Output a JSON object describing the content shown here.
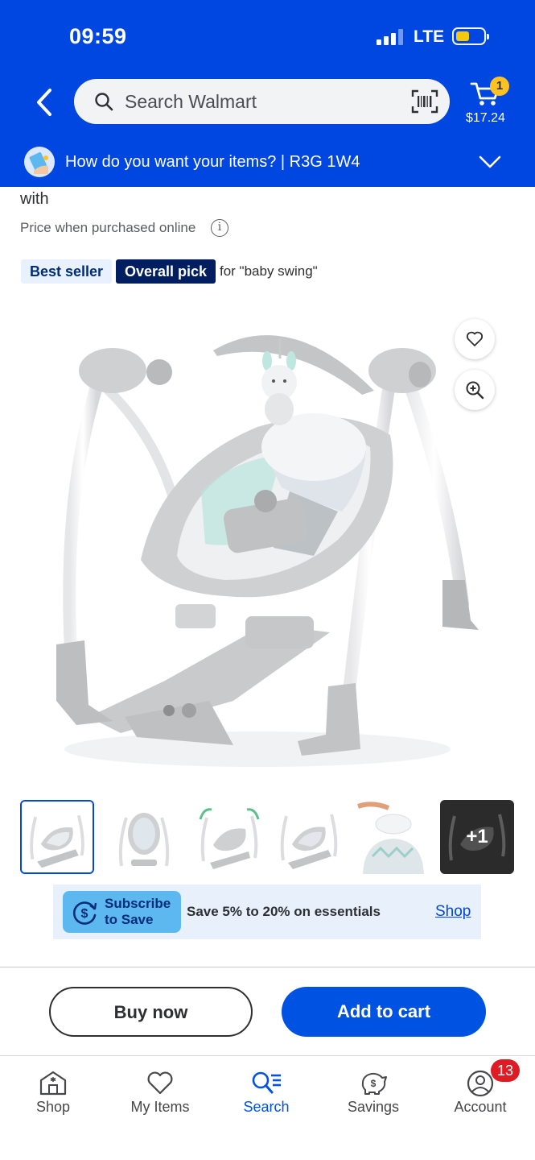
{
  "status_bar": {
    "time": "09:59",
    "network": "LTE"
  },
  "header": {
    "search_placeholder": "Search Walmart",
    "cart_count": "1",
    "cart_total": "$17.24",
    "fulfillment_prompt": "How do you want your items? | R3G 1W4"
  },
  "product": {
    "title_fragment": "with",
    "price_note": "Price when purchased online",
    "info_glyph": "i",
    "badges": {
      "best_seller": "Best seller",
      "overall_pick": "Overall pick",
      "for_query": "for \"baby swing\""
    },
    "more_images_label": "+1"
  },
  "promo": {
    "subscribe_line1": "Subscribe",
    "subscribe_line2": "to Save",
    "text": "Save 5% to 20% on essentials",
    "link": "Shop"
  },
  "actions": {
    "buy_now": "Buy now",
    "add_to_cart": "Add to cart"
  },
  "bottom_nav": {
    "items": [
      {
        "label": "Shop",
        "icon": "store-icon"
      },
      {
        "label": "My Items",
        "icon": "heart-icon"
      },
      {
        "label": "Search",
        "icon": "search-list-icon"
      },
      {
        "label": "Savings",
        "icon": "piggy-bank-icon"
      },
      {
        "label": "Account",
        "icon": "account-icon"
      }
    ],
    "account_badge": "13"
  },
  "colors": {
    "brand_blue": "#0046e0",
    "cart_badge": "#ffc220",
    "alert_red": "#de1c24",
    "button_blue": "#0053e2",
    "overall_pick_navy": "#001e60"
  }
}
